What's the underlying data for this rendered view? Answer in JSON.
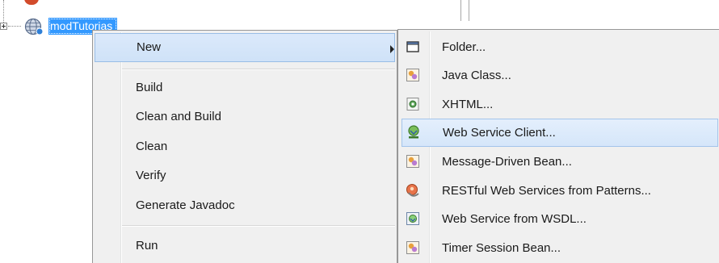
{
  "tree": {
    "project_name": "modTutorias",
    "expander_icon": "plus-box-icon",
    "project_icon": "globe-icon"
  },
  "context_menu": {
    "items": [
      {
        "label": "New",
        "has_submenu": true,
        "highlighted": true
      },
      {
        "label": "Build"
      },
      {
        "label": "Clean and Build"
      },
      {
        "label": "Clean"
      },
      {
        "label": "Verify"
      },
      {
        "label": "Generate Javadoc"
      },
      {
        "label": "Run"
      }
    ]
  },
  "submenu": {
    "items": [
      {
        "label": "Folder...",
        "icon": "folder-icon"
      },
      {
        "label": "Java Class...",
        "icon": "java-class-icon"
      },
      {
        "label": "XHTML...",
        "icon": "xhtml-file-icon"
      },
      {
        "label": "Web Service Client...",
        "icon": "web-service-client-icon",
        "highlighted": true
      },
      {
        "label": "Message-Driven Bean...",
        "icon": "message-driven-bean-icon"
      },
      {
        "label": "RESTful Web Services from Patterns...",
        "icon": "restful-service-icon"
      },
      {
        "label": "Web Service from WSDL...",
        "icon": "wsdl-service-icon"
      },
      {
        "label": "Timer Session Bean...",
        "icon": "timer-session-bean-icon"
      }
    ]
  },
  "colors": {
    "selection": "#3399ff",
    "menu_background": "#f0f0f0",
    "menu_highlight": "#cfe2f8",
    "menu_highlight_border": "#99bde6"
  }
}
